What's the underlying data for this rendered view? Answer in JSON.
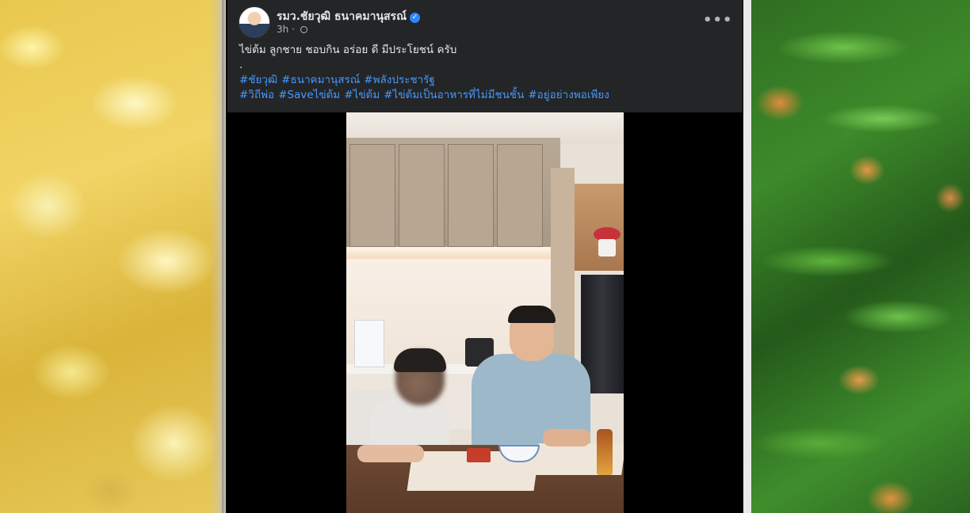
{
  "post": {
    "author": "รมว.ชัยวุฒิ ธนาคมานุสรณ์",
    "verified_mark": "✓",
    "time": "3h",
    "more_label": "•••",
    "text_line1": "ไข่ต้ม  ลูกชาย ชอบกิน อร่อย ดี มีประโยชน์ ครับ",
    "text_line2": ".",
    "hashtags_line1": [
      "#ชัยวุฒิ",
      "#ธนาคมานุสรณ์",
      "#พลังประชารัฐ"
    ],
    "hashtags_line2": [
      "#วิถีพ่อ",
      "#Saveไข่ต้ม",
      "#ไข่ต้ม",
      "#ไข่ต้มเป็นอาหารที่ไม่มีชนชั้น",
      "#อยู่อย่างพอเพียง"
    ]
  },
  "icons": {
    "avatar": "profile-photo",
    "verified": "verified-badge-icon",
    "privacy": "globe-icon",
    "more": "more-horizontal-icon"
  },
  "colors": {
    "card_bg": "#242526",
    "text": "#e4e6eb",
    "hashtag": "#4599ff",
    "meta": "#b0b3b8",
    "verified": "#2d88ff"
  }
}
